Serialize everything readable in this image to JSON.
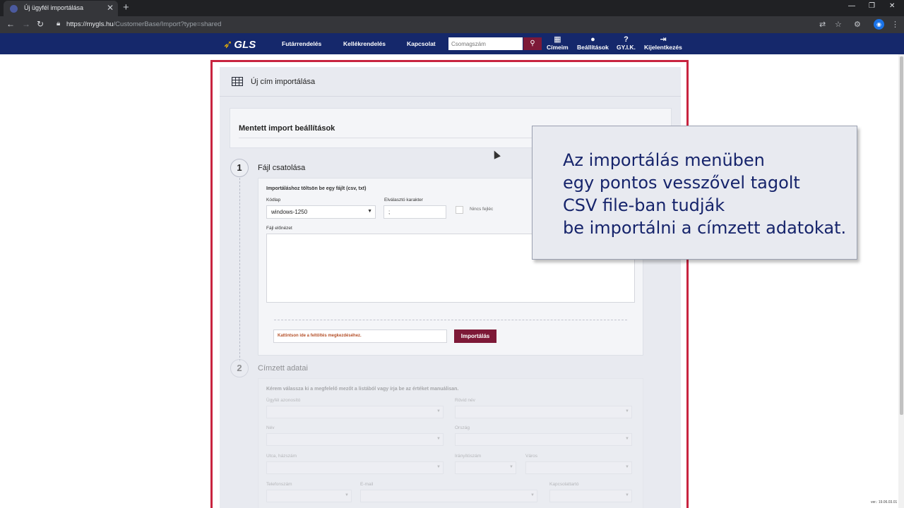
{
  "browser": {
    "tab_title": "Új ügyfél importálása",
    "tab_close": "✕",
    "new_tab": "+",
    "url_host": "https://mygls.hu",
    "url_path": "/CustomerBase/Import?type=shared",
    "window_controls": [
      "—",
      "❐",
      "✕"
    ]
  },
  "nav": {
    "logo_text": "GLS",
    "links": [
      "Futárrendelés",
      "Kellékrendelés",
      "Kapcsolat"
    ],
    "search_placeholder": "Csomagszám",
    "icons": [
      {
        "label": "Címeim",
        "icon": "table-icon"
      },
      {
        "label": "Beállítások",
        "icon": "user-icon"
      },
      {
        "label": "GY.I.K.",
        "icon": "question-icon"
      },
      {
        "label": "Kijelentkezés",
        "icon": "logout-icon"
      }
    ]
  },
  "page": {
    "title": "Új cím importálása",
    "saved_settings": "Mentett import beállítások",
    "step1": {
      "number": "1",
      "title": "Fájl csatolása",
      "instruction": "Importáláshoz töltsön be egy fájlt (csv, txt)",
      "codepage_label": "Kódlap",
      "codepage_value": "windows-1250",
      "separator_label": "Elválasztó karakter",
      "separator_value": ";",
      "no_header_label": "Nincs fejléc",
      "preview_label": "Fájl előnézet",
      "upload_hint": "Kattintson ide a feltöltés megkezdéséhez.",
      "import_button": "Importálás"
    },
    "step2": {
      "number": "2",
      "title": "Címzett adatai",
      "instruction": "Kérem válassza ki a megfelelő mezőt a listából vagy írja be az értéket manuálisan.",
      "fields": {
        "customer_id": "Ügyfél azonosító",
        "short_name": "Rövid név",
        "name": "Név",
        "country": "Ország",
        "street": "Utca, házszám",
        "zip": "Irányítószám",
        "city": "Város",
        "phone": "Telefonszám",
        "email": "E-mail",
        "contact": "Kapcsolattartó"
      }
    },
    "version": "ver.: 19.06.03.01"
  },
  "callout": {
    "lines": [
      "Az importálás menüben",
      "egy pontos vesszővel tagolt",
      "CSV file-ban tudják",
      "be importálni a címzett adatokat."
    ]
  },
  "colors": {
    "nav_bg": "#15286b",
    "accent": "#7d1937",
    "frame": "#c8243f",
    "callout_text": "#16246b"
  }
}
